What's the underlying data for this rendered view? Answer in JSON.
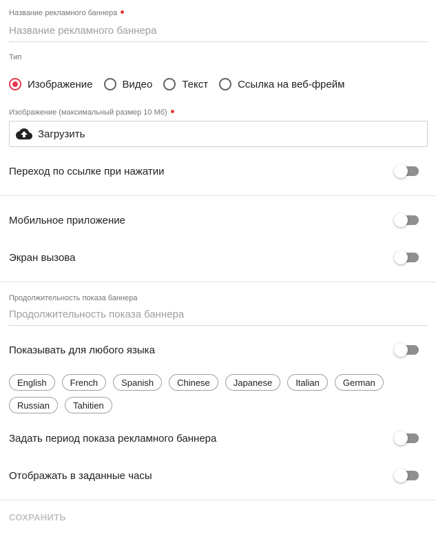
{
  "banner_name": {
    "label": "Название рекламного баннера",
    "placeholder": "Название рекламного баннера",
    "value": ""
  },
  "type": {
    "label": "Тип",
    "options": [
      {
        "label": "Изображение",
        "selected": true
      },
      {
        "label": "Видео",
        "selected": false
      },
      {
        "label": "Текст",
        "selected": false
      },
      {
        "label": "Ссылка на веб-фрейм",
        "selected": false
      }
    ]
  },
  "image": {
    "label": "Изображение (максимальный размер 10 Мб)",
    "upload_label": "Загрузить",
    "upload_icon": "cloud-upload-icon"
  },
  "toggles": {
    "follow_link": {
      "label": "Переход по ссылке при нажатии",
      "on": false
    },
    "mobile_app": {
      "label": "Мобильное приложение",
      "on": false
    },
    "call_screen": {
      "label": "Экран вызова",
      "on": false
    },
    "any_language": {
      "label": "Показывать для любого языка",
      "on": false
    },
    "set_period": {
      "label": "Задать период показа рекламного баннера",
      "on": false
    },
    "hours": {
      "label": "Отображать в заданные часы",
      "on": false
    }
  },
  "duration": {
    "label": "Продолжительность показа баннера",
    "placeholder": "Продолжительность показа баннера",
    "value": ""
  },
  "languages": [
    "English",
    "French",
    "Spanish",
    "Chinese",
    "Japanese",
    "Italian",
    "German",
    "Russian",
    "Tahitien"
  ],
  "actions": {
    "save_label": "СОХРАНИТЬ"
  },
  "colors": {
    "accent": "#e53950",
    "required_dot": "#e53935",
    "toggle_off_track": "#8f8f8f",
    "disabled_text": "#c2c2c2"
  }
}
